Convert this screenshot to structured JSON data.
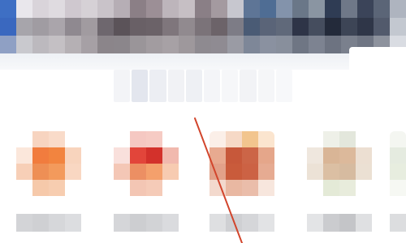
{
  "window": {
    "title": ""
  },
  "colors": {
    "browser_blue": "#4a78c8",
    "annotation_red": "#d2452c",
    "tile_orange": "#f07c3e",
    "tile_red": "#d8442c",
    "tile_brick": "#c95a3a",
    "tile_tan": "#d7b394",
    "label_gray": "#d8d9db"
  },
  "toolbar": {
    "address_text": ""
  },
  "shortcuts": [
    {
      "name": "shortcut-1",
      "label": "",
      "icon": "orange-app-icon"
    },
    {
      "name": "shortcut-2",
      "label": "",
      "icon": "red-app-icon"
    },
    {
      "name": "shortcut-3",
      "label": "",
      "icon": "folder-app-icon"
    },
    {
      "name": "shortcut-4",
      "label": "",
      "icon": "tan-app-icon"
    },
    {
      "name": "shortcut-5",
      "label": "",
      "icon": "partial-app-icon"
    }
  ],
  "annotation": {
    "type": "red-arrow-line"
  }
}
